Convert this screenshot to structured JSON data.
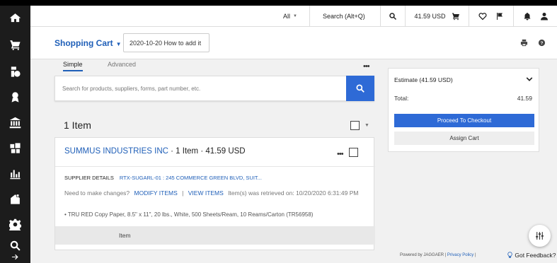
{
  "topbar": {
    "scope_label": "All",
    "search_placeholder": "Search (Alt+Q)",
    "cart_total": "41.59 USD"
  },
  "sidebar": {
    "items": [
      {
        "icon": "home-icon"
      },
      {
        "icon": "cart-icon"
      },
      {
        "icon": "procurement-icon"
      },
      {
        "icon": "award-icon"
      },
      {
        "icon": "institution-icon"
      },
      {
        "icon": "suppliers-icon"
      },
      {
        "icon": "analytics-icon"
      },
      {
        "icon": "store-icon"
      },
      {
        "icon": "gear-icon"
      },
      {
        "icon": "search-icon"
      },
      {
        "icon": "arrow-right-icon"
      }
    ]
  },
  "cart": {
    "title": "Shopping Cart",
    "name": "2020-10-20 How to add it"
  },
  "tabs": [
    {
      "label": "Simple",
      "active": true
    },
    {
      "label": "Advanced",
      "active": false
    }
  ],
  "product_search": {
    "placeholder": "Search for products, suppliers, forms, part number, etc."
  },
  "items_header": "1 Item",
  "supplier": {
    "name": "SUMMUS INDUSTRIES INC",
    "meta": " · 1 Item  · 41.59 USD",
    "details_label": "SUPPLIER DETAILS",
    "details_value": "RTX-SUGARL-01 : 245 COMMERCE GREEN BLVD, SUIT...",
    "changes_prefix": "Need to make changes?",
    "modify_items": "MODIFY ITEMS",
    "separator": "|",
    "view_items": "VIEW ITEMS",
    "retrieved": "Item(s) was retrieved on: 10/20/2020 6:31:49 PM",
    "product_line": "TRU RED Copy Paper, 8.5\" x 11\", 20 lbs., White, 500 Sheets/Ream, 10 Reams/Carton (TR56958)",
    "column_item": "Item"
  },
  "estimate": {
    "title": "Estimate (41.59 USD)",
    "total_label": "Total:",
    "total_value": "41.59",
    "checkout": "Proceed To Checkout",
    "assign": "Assign Cart"
  },
  "footer": {
    "powered": "Powered by JAGGAER |",
    "privacy": "Privacy Policy",
    "sep": "|",
    "feedback": "Got Feedback?"
  },
  "colors": {
    "accent": "#2e6ad6",
    "link": "#1f5fb8",
    "sidebar": "#1c1c1c"
  }
}
